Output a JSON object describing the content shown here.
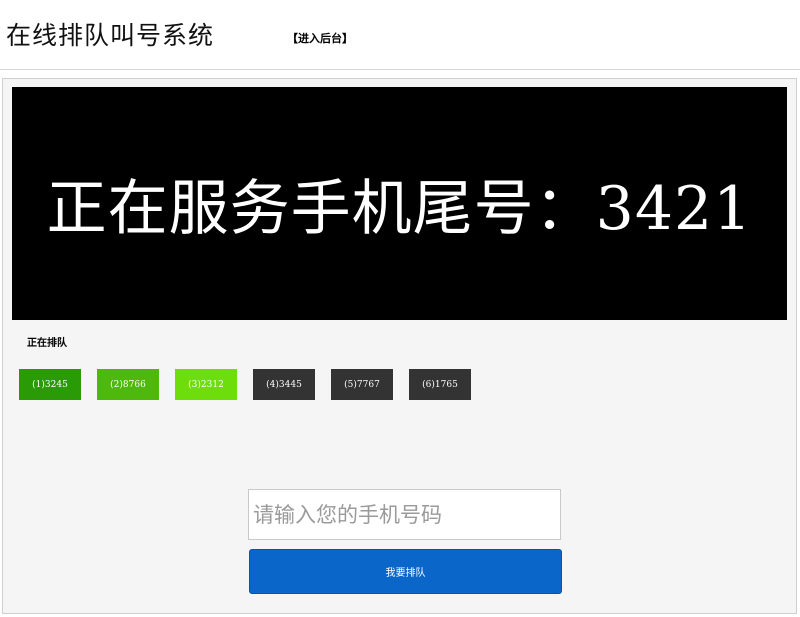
{
  "header": {
    "title": "在线排队叫号系统",
    "admin_link": "【进入后台】"
  },
  "display": {
    "text": "正在服务手机尾号：3421"
  },
  "queue": {
    "label": "正在排队",
    "items": [
      {
        "label": "(1)3245",
        "color": "#2a9b07"
      },
      {
        "label": "(2)8766",
        "color": "#4fb80c"
      },
      {
        "label": "(3)2312",
        "color": "#6ddd0b"
      },
      {
        "label": "(4)3445",
        "color": "#333333"
      },
      {
        "label": "(5)7767",
        "color": "#333333"
      },
      {
        "label": "(6)1765",
        "color": "#333333"
      }
    ]
  },
  "form": {
    "phone_placeholder": "请输入您的手机号码",
    "phone_value": "",
    "submit_label": "我要排队"
  }
}
